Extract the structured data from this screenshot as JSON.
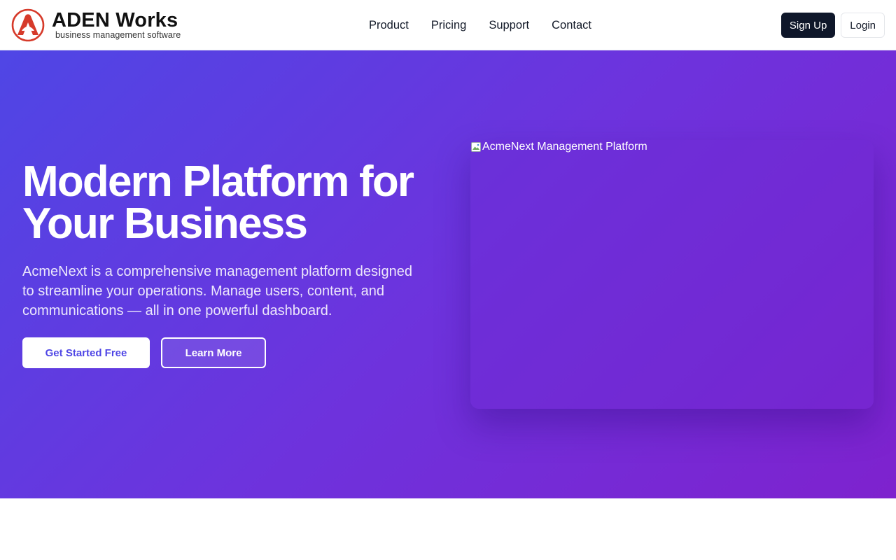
{
  "header": {
    "logo": {
      "title": "ADEN Works",
      "subtitle": "business management software",
      "icon": "aden-logo-icon",
      "accent_color": "#d63a2a"
    },
    "nav": [
      {
        "label": "Product"
      },
      {
        "label": "Pricing"
      },
      {
        "label": "Support"
      },
      {
        "label": "Contact"
      }
    ],
    "actions": {
      "signup_label": "Sign Up",
      "login_label": "Login"
    }
  },
  "hero": {
    "title": "Modern Platform for Your Business",
    "description": "AcmeNext is a comprehensive management platform designed to streamline your operations. Manage users, content, and communications — all in one powerful dashboard.",
    "primary_cta": "Get Started Free",
    "secondary_cta": "Learn More",
    "image_alt": "AcmeNext Management Platform",
    "gradient": [
      "#4f46e5",
      "#7e22ce"
    ]
  }
}
